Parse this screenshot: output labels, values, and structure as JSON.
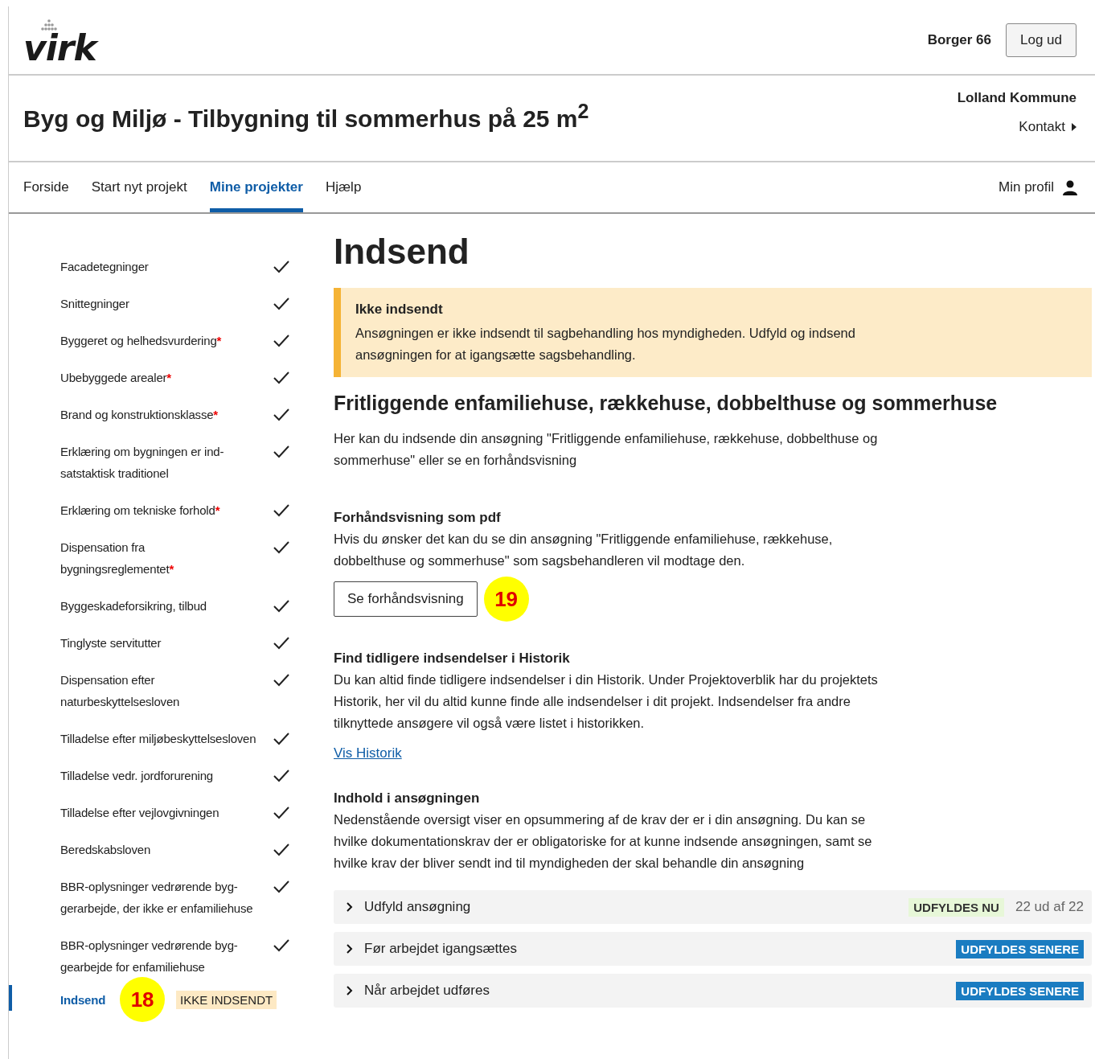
{
  "header": {
    "logo": "virk",
    "user": "Borger 66",
    "logout": "Log ud"
  },
  "title_band": {
    "title": "Byg og Miljø - Tilbygning til sommerhus på 25 m$^{2}$",
    "municipality": "Lolland Kommune",
    "contact": "Kontakt"
  },
  "nav": {
    "items": [
      {
        "label": "Forside",
        "selected": false
      },
      {
        "label": "Start nyt projekt",
        "selected": false
      },
      {
        "label": "Mine projekter",
        "selected": true
      },
      {
        "label": "Hjælp",
        "selected": false
      }
    ],
    "profile": "Min profil"
  },
  "steps": [
    {
      "label": "Facadetegninger",
      "checked": true,
      "selected": false
    },
    {
      "label": "Snittegninger",
      "checked": true,
      "selected": false
    },
    {
      "label": "Byggeret og helhedsvurdering",
      "mark": "*",
      "checked": true,
      "selected": false
    },
    {
      "label": "Ubebyggede arealer",
      "mark": "*",
      "checked": true,
      "selected": false
    },
    {
      "label": "Brand og konstruktionsklasse",
      "mark": "*",
      "checked": true,
      "selected": false
    },
    {
      "label": "Erklæring om bygningen er ind-satstaktisk traditionel",
      "checked": true,
      "selected": false
    },
    {
      "label": "Erklæring om tekniske forhold",
      "mark": "*",
      "checked": true,
      "selected": false
    },
    {
      "label": "Dispensation fra bygningsreglementet",
      "mark": "*",
      "checked": true,
      "selected": false
    },
    {
      "label": "Byggeskadeforsikring, tilbud",
      "checked": true,
      "selected": false
    },
    {
      "label": "Tinglyste servitutter",
      "checked": true,
      "selected": false
    },
    {
      "label": "Dispensation efter naturbeskyttelsesloven",
      "checked": true,
      "selected": false
    },
    {
      "label": "Tilladelse efter miljøbeskyttelsesloven",
      "checked": true,
      "selected": false
    },
    {
      "label": "Tilladelse vedr. jordforurening",
      "checked": true,
      "selected": false
    },
    {
      "label": "Tilladelse efter vejlovgivningen",
      "checked": true,
      "selected": false
    },
    {
      "label": "Beredskabsloven",
      "checked": true,
      "selected": false
    },
    {
      "label": "BBR-oplysninger vedrørende byg-gerarbejde, der ikke er enfamiliehuse",
      "checked": true,
      "selected": false
    },
    {
      "label": "BBR-oplysninger vedrørende byg-gearbejde for enfamiliehuse",
      "checked": true,
      "selected": false
    },
    {
      "label": "Indsend",
      "checked": false,
      "selected": true,
      "callout": "18",
      "status": "IKKE INDSENDT"
    }
  ],
  "main": {
    "heading": "Indsend",
    "notice": {
      "title": "Ikke indsendt",
      "text": "Ansøgningen er ikke indsendt til sagbehandling hos myndigheden. Udfyld og indsend ansøgningen for at igangsætte sagsbehandling."
    },
    "subheading": "Fritliggende enfamiliehuse, rækkehuse, dobbelthuse og sommerhuse",
    "intro": "Her kan du indsende din ansøgning \"Fritliggende enfamiliehuse, rækkehuse, dobbelthuse og sommerhuse\" eller se en forhåndsvisning",
    "preview": {
      "title": "Forhåndsvisning som pdf",
      "text": "Hvis du ønsker det kan du se din ansøgning \"Fritliggende enfamiliehuse, rækkehuse, dobbelthuse og sommerhuse\" som sagsbehandleren vil modtage den.",
      "button": "Se forhåndsvisning",
      "callout": "19"
    },
    "history": {
      "title": "Find tidligere indsendelser i Historik",
      "text": "Du kan altid finde tidligere indsendelser i din Historik. Under Projektoverblik har du projektets Historik, her vil du altid kunne finde alle indsendelser i dit projekt. Indsendelser fra andre tilknyttede ansøgere vil også være listet i historikken.",
      "link": "Vis Historik"
    },
    "content": {
      "title": "Indhold i ansøgningen",
      "text": "Nedenstående oversigt viser en opsummering af de krav der er i din ansøgning. Du kan se hvilke dokumentationskrav der er obligatoriske for at kunne indsende ansøgningen, samt se hvilke krav der bliver sendt ind til myndigheden der skal behandle din ansøgning"
    },
    "sections": [
      {
        "label": "Udfyld ansøgning",
        "badge": "UDFYLDES NU",
        "kind": "now",
        "count": "22 ud af 22"
      },
      {
        "label": "Før arbejdet igangsættes",
        "badge": "UDFYLDES SENERE",
        "kind": "later"
      },
      {
        "label": "Når arbejdet udføres",
        "badge": "UDFYLDES SENERE",
        "kind": "later"
      }
    ]
  }
}
